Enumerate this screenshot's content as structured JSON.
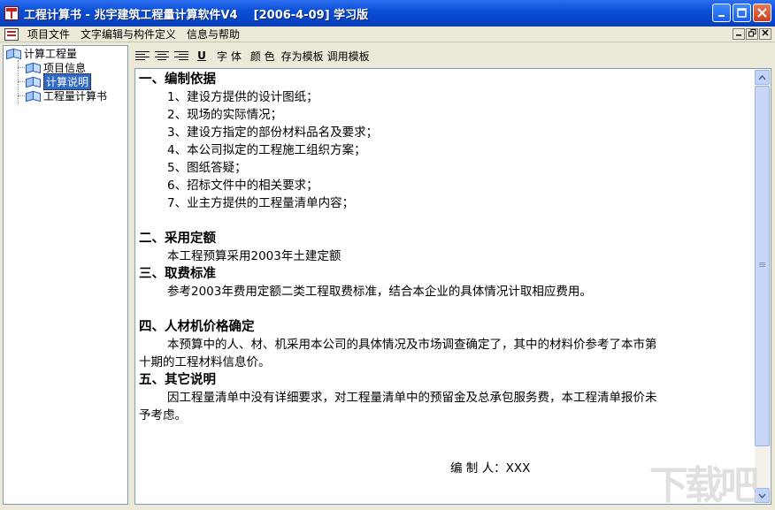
{
  "window": {
    "title": "工程计算书 - 兆宇建筑工程量计算软件V4    [2006-4-09] 学习版"
  },
  "menubar": {
    "items": [
      "项目文件",
      "文字编辑与构件定义",
      "信息与帮助"
    ]
  },
  "tree": {
    "root": "计算工程量",
    "children": [
      "项目信息",
      "计算说明",
      "工程量计算书"
    ],
    "selected": "计算说明"
  },
  "toolbar": {
    "underline": "U",
    "font": "字 体",
    "color": "颜 色",
    "save_template": "存为模板",
    "load_template": "调用模板"
  },
  "document": {
    "s1_title": "一、编制依据",
    "s1_items": [
      "1、建设方提供的设计图纸；",
      "2、现场的实际情况；",
      "3、建设方指定的部份材料品名及要求；",
      "4、本公司拟定的工程施工组织方案；",
      "5、图纸答疑；",
      "6、招标文件中的相关要求；",
      "7、业主方提供的工程量清单内容；"
    ],
    "s2_title": "二、采用定额",
    "s2_text": "本工程预算采用2003年土建定额",
    "s3_title": "三、取费标准",
    "s3_text": "参考2003年费用定额二类工程取费标准，结合本企业的具体情况计取相应费用。",
    "s4_title": "四、人材机价格确定",
    "s4_line1": "本预算中的人、材、机采用本公司的具体情况及市场调查确定了，其中的材料价参考了本市第",
    "s4_line2": "十期的工程材料信息价。",
    "s5_title": "五、其它说明",
    "s5_line1": "因工程量清单中没有详细要求，对工程量清单中的预留金及总承包服务费，本工程清单报价未",
    "s5_line2": "予考虑。",
    "signature": "编 制 人：XXX"
  },
  "watermark": {
    "text": "下载吧"
  }
}
